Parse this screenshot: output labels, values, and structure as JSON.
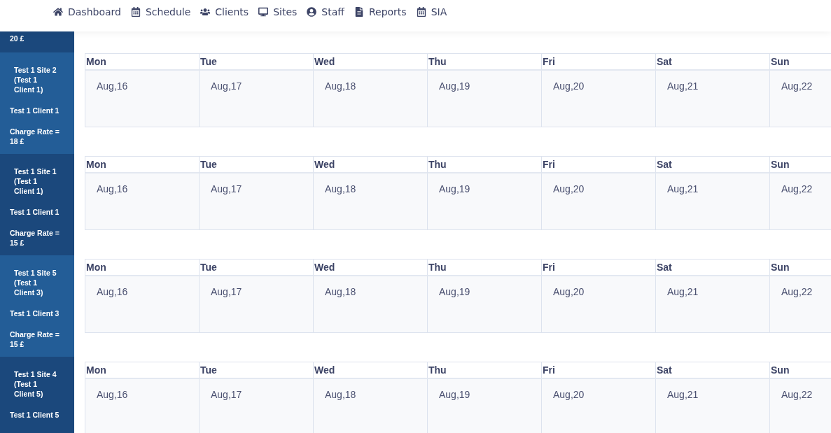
{
  "nav": [
    {
      "kind": "home",
      "label": "Dashboard"
    },
    {
      "kind": "calendar",
      "label": "Schedule"
    },
    {
      "kind": "users",
      "label": "Clients"
    },
    {
      "kind": "desktop",
      "label": "Sites"
    },
    {
      "kind": "user",
      "label": "Staff"
    },
    {
      "kind": "file",
      "label": "Reports"
    },
    {
      "kind": "calendar",
      "label": "SIA"
    }
  ],
  "sites": [
    {
      "charge": "20 £"
    },
    {
      "name": "Test 1 Site 2 (Test 1 Client 1)",
      "client": "Test 1 Client 1",
      "charge": "Charge Rate = 18 £"
    },
    {
      "name": "Test 1 Site 1 (Test 1 Client 1)",
      "client": "Test 1 Client 1",
      "charge": "Charge Rate = 15 £"
    },
    {
      "name": "Test 1 Site 5 (Test 1 Client 3)",
      "client": "Test 1 Client 3",
      "charge": "Charge Rate = 15 £"
    },
    {
      "name": "Test 1 Site 4 (Test 1 Client 5)",
      "client": "Test 1 Client 5"
    }
  ],
  "weeks": [
    {
      "days": [
        {
          "day": "Mon",
          "date": "Aug,16"
        },
        {
          "day": "Tue",
          "date": "Aug,17"
        },
        {
          "day": "Wed",
          "date": "Aug,18"
        },
        {
          "day": "Thu",
          "date": "Aug,19"
        },
        {
          "day": "Fri",
          "date": "Aug,20"
        },
        {
          "day": "Sat",
          "date": "Aug,21"
        },
        {
          "day": "Sun",
          "date": "Aug,22"
        }
      ]
    },
    {
      "days": [
        {
          "day": "Mon",
          "date": "Aug,16"
        },
        {
          "day": "Tue",
          "date": "Aug,17"
        },
        {
          "day": "Wed",
          "date": "Aug,18"
        },
        {
          "day": "Thu",
          "date": "Aug,19"
        },
        {
          "day": "Fri",
          "date": "Aug,20"
        },
        {
          "day": "Sat",
          "date": "Aug,21"
        },
        {
          "day": "Sun",
          "date": "Aug,22"
        }
      ]
    },
    {
      "days": [
        {
          "day": "Mon",
          "date": "Aug,16"
        },
        {
          "day": "Tue",
          "date": "Aug,17"
        },
        {
          "day": "Wed",
          "date": "Aug,18"
        },
        {
          "day": "Thu",
          "date": "Aug,19"
        },
        {
          "day": "Fri",
          "date": "Aug,20"
        },
        {
          "day": "Sat",
          "date": "Aug,21"
        },
        {
          "day": "Sun",
          "date": "Aug,22"
        }
      ]
    },
    {
      "days": [
        {
          "day": "Mon",
          "date": "Aug,16"
        },
        {
          "day": "Tue",
          "date": "Aug,17"
        },
        {
          "day": "Wed",
          "date": "Aug,18"
        },
        {
          "day": "Thu",
          "date": "Aug,19"
        },
        {
          "day": "Fri",
          "date": "Aug,20"
        },
        {
          "day": "Sat",
          "date": "Aug,21"
        },
        {
          "day": "Sun",
          "date": "Aug,22"
        }
      ]
    }
  ]
}
